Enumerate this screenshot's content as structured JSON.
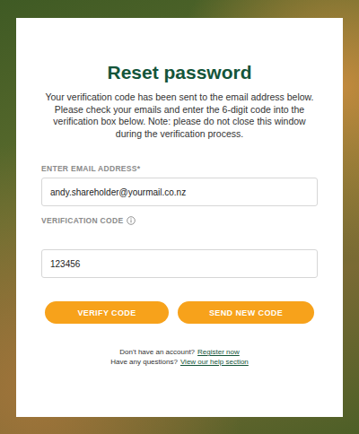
{
  "title": "Reset password",
  "description": "Your verification code has been sent to the email address below. Please check your emails and enter the 6-digit code into the verification box below. Note: please do not close this window during the verification process.",
  "fields": [
    {
      "label": "ENTER EMAIL ADDRESS*",
      "value": "andy.shareholder@yourmail.co.nz",
      "info": false
    },
    {
      "label": "VERIFICATION CODE",
      "value": "123456",
      "info": true
    }
  ],
  "buttons": [
    "VERIFY CODE",
    "SEND NEW CODE"
  ],
  "footer": [
    {
      "text": "Don't have an account?",
      "link": "Register now"
    },
    {
      "text": "Have any questions?",
      "link": "View our help section"
    }
  ]
}
